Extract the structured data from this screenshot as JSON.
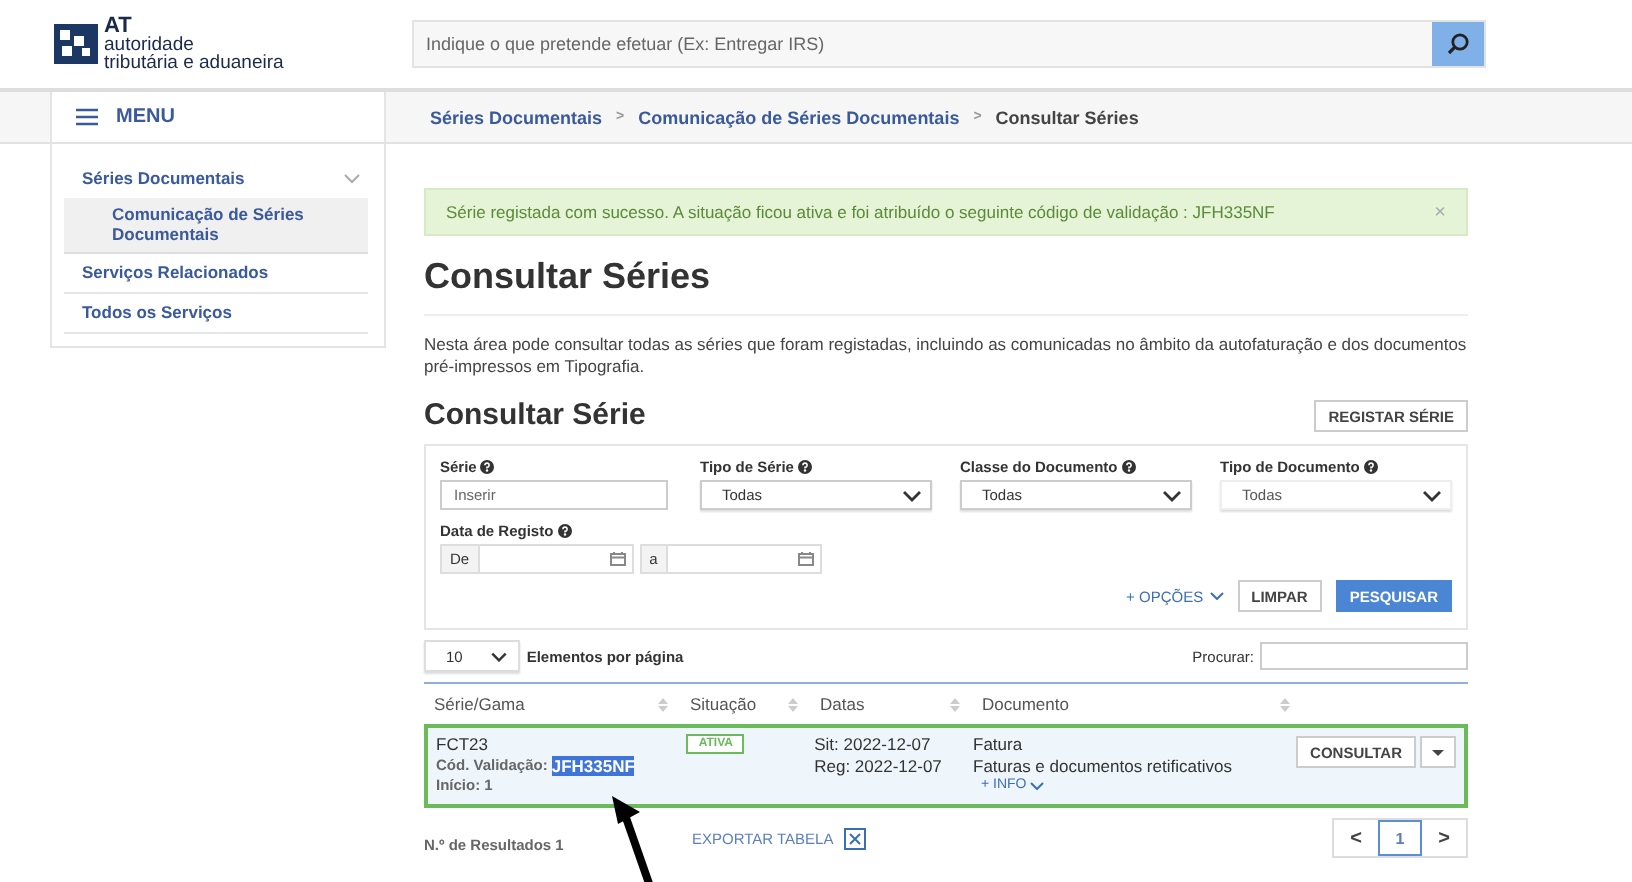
{
  "header": {
    "logo_short": "AT",
    "logo_line1": "autoridade",
    "logo_line2": "tributária e aduaneira",
    "search": {
      "placeholder": "Indique o que pretende efetuar (Ex: Entregar IRS)"
    }
  },
  "menu": {
    "title": "MENU",
    "items": [
      {
        "label": "Séries Documentais",
        "expanded": true,
        "selected": false,
        "children": [
          {
            "label": "Comunicação de Séries Documentais",
            "selected": true
          }
        ]
      },
      {
        "label": "Serviços Relacionados",
        "selected": false
      },
      {
        "label": "Todos os Serviços",
        "selected": false
      }
    ]
  },
  "breadcrumb": [
    {
      "label": "Séries Documentais",
      "link": true
    },
    {
      "separator": ">",
      "label": "Comunicação de Séries Documentais",
      "link": true
    },
    {
      "separator": ">",
      "label": "Consultar Séries",
      "link": false
    }
  ],
  "alert": {
    "text": "Série registada com sucesso. A situação ficou ativa e foi atribuído o seguinte código de validação : JFH335NF",
    "close": "×"
  },
  "page_title": "Consultar Séries",
  "intro": "Nesta área pode consultar todas as séries que foram registadas, incluindo as comunicadas no âmbito da autofaturação e dos documentos pré-impressos em Tipografia.",
  "section_title": "Consultar Série",
  "register_button": "REGISTAR SÉRIE",
  "filters": [
    {
      "label": "Série",
      "kind": "text",
      "placeholder": "Inserir"
    },
    {
      "label": "Tipo de Série",
      "kind": "select",
      "value": "Todas"
    },
    {
      "label": "Classe do Documento",
      "kind": "select",
      "value": "Todas"
    },
    {
      "label": "Tipo de Documento",
      "kind": "select",
      "value": "Todas"
    }
  ],
  "date_filter": {
    "label": "Data de Registo",
    "from": "De",
    "to": "a"
  },
  "options_link": "+ OPÇÕES",
  "clear_button": "LIMPAR",
  "search_button": "PESQUISAR",
  "per_page": {
    "value": "10",
    "label": "Elementos por página"
  },
  "search_label": "Procurar:",
  "table": {
    "columns": [
      "Série/Gama",
      "Situação",
      "Datas",
      "Documento"
    ],
    "rows": [
      {
        "series": "FCT23",
        "code_label": "Cód. Validação:",
        "code": "JFH335NF",
        "code_highlighted": true,
        "start": "Início: 1",
        "status": "ATIVA",
        "sit": "Sit: 2022-12-07",
        "reg": "Reg: 2022-12-07",
        "doc": "Fatura",
        "doc_desc": "Faturas e documentos retificativos",
        "info": "+ INFO",
        "action": "CONSULTAR",
        "selected": true
      }
    ]
  },
  "results": "N.º de Resultados 1",
  "export": "EXPORTAR TABELA",
  "pagination": {
    "prev": "<",
    "page": "1",
    "next": ">"
  }
}
